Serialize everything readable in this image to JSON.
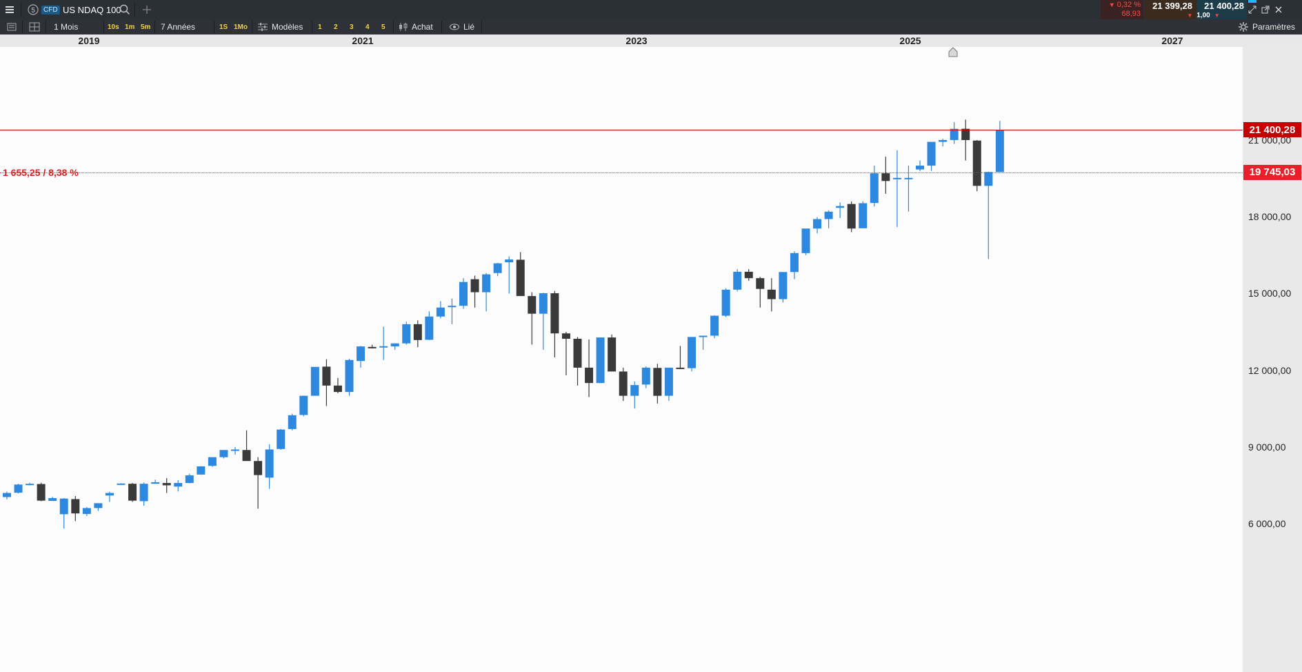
{
  "topbar": {
    "menu_icon": "hamburger-icon",
    "cfd_badge": "CFD",
    "instrument_name": "US NDAQ 100",
    "search_icon": "search-icon",
    "add_icon": "plus-icon",
    "change_pct": "0,32 %",
    "change_abs": "68,93",
    "bid": "21 399,28",
    "ask": "21 400,28",
    "spread": "1,00",
    "window_icons": [
      "restore-icon",
      "popout-icon",
      "close-icon"
    ]
  },
  "toolbar": {
    "period": "1 Mois",
    "intervals_small": [
      "10s",
      "1m",
      "5m"
    ],
    "range": "7 Années",
    "intervals_big": [
      "1S",
      "1Mo"
    ],
    "models": "Modèles",
    "numbers": [
      "1",
      "2",
      "3",
      "4",
      "5"
    ],
    "buy": "Achat",
    "linked": "Lié",
    "settings": "Paramètres"
  },
  "xaxis": {
    "years": [
      "2019",
      "2021",
      "2023",
      "2025",
      "2027"
    ]
  },
  "yaxis": {
    "labels": [
      "21 000,00",
      "18 000,00",
      "15 000,00",
      "12 000,00",
      "9 000,00",
      "6 000,00"
    ]
  },
  "price_lines": {
    "current_value": "21 400,28",
    "current_color": "#c40000",
    "reference_value": "19 745,03",
    "reference_color": "#e8202a",
    "difference_label": "1 655,25 / 8,38 %"
  },
  "colors": {
    "bull": "#2d89e0",
    "bear": "#3a3a3a",
    "toolbar_yellow": "#f2d43a"
  },
  "chart_data": {
    "type": "candlestick",
    "timeframe": "1 Mois",
    "x": [
      "2019-01",
      "2019-02",
      "2019-03",
      "2019-04",
      "2019-05",
      "2019-06",
      "2019-07",
      "2019-08",
      "2019-09",
      "2019-10",
      "2019-11",
      "2019-12",
      "2020-01",
      "2020-02",
      "2020-03",
      "2020-04",
      "2020-05",
      "2020-06",
      "2020-07",
      "2020-08",
      "2020-09",
      "2020-10",
      "2020-11",
      "2020-12",
      "2021-01",
      "2021-02",
      "2021-03",
      "2021-04",
      "2021-05",
      "2021-06",
      "2021-07",
      "2021-08",
      "2021-09",
      "2021-10",
      "2021-11",
      "2021-12",
      "2022-01",
      "2022-02",
      "2022-03",
      "2022-04",
      "2022-05",
      "2022-06",
      "2022-07",
      "2022-08",
      "2022-09",
      "2022-10",
      "2022-11",
      "2022-12",
      "2023-01",
      "2023-02",
      "2023-03",
      "2023-04",
      "2023-05",
      "2023-06",
      "2023-07",
      "2023-08",
      "2023-09",
      "2023-10",
      "2023-11",
      "2023-12",
      "2024-01",
      "2024-02",
      "2024-03",
      "2024-04",
      "2024-05",
      "2024-06",
      "2024-07",
      "2024-08",
      "2024-09",
      "2024-10",
      "2024-11",
      "2024-12",
      "2025-01",
      "2025-02",
      "2025-03",
      "2025-04",
      "2025-05",
      "2025-06"
    ],
    "series": [
      {
        "values": [
          [
            7040,
            7250,
            6950,
            7200
          ],
          [
            7210,
            7560,
            7180,
            7530
          ],
          [
            7540,
            7600,
            7500,
            7560
          ],
          [
            7550,
            7600,
            6880,
            6900
          ],
          [
            6890,
            7050,
            6900,
            7000
          ],
          [
            6370,
            7000,
            5810,
            6980
          ],
          [
            6960,
            7080,
            6100,
            6400
          ],
          [
            6380,
            6650,
            6300,
            6610
          ],
          [
            6610,
            6800,
            6500,
            6800
          ],
          [
            7100,
            7250,
            6850,
            7200
          ],
          [
            7560,
            7580,
            7520,
            7570
          ],
          [
            7560,
            7590,
            6850,
            6900
          ],
          [
            6880,
            7610,
            6700,
            7560
          ],
          [
            7560,
            7720,
            7560,
            7620
          ],
          [
            7590,
            7780,
            7200,
            7500
          ],
          [
            7450,
            7700,
            7260,
            7590
          ],
          [
            7590,
            7950,
            7580,
            7890
          ],
          [
            7920,
            8250,
            7910,
            8240
          ],
          [
            8260,
            8600,
            8220,
            8600
          ],
          [
            8600,
            8850,
            8550,
            8880
          ],
          [
            8880,
            9000,
            8700,
            8900
          ],
          [
            8880,
            9650,
            8680,
            8450
          ],
          [
            8450,
            8600,
            6590,
            7900
          ],
          [
            7800,
            9100,
            7360,
            8900
          ],
          [
            8920,
            9700,
            8890,
            9680
          ],
          [
            9700,
            10300,
            9650,
            10240
          ],
          [
            10250,
            11000,
            10200,
            11000
          ],
          [
            11000,
            11100,
            11050,
            12130
          ],
          [
            12140,
            12430,
            10600,
            11400
          ],
          [
            11400,
            11700,
            11100,
            11150
          ],
          [
            11150,
            12450,
            11000,
            12400
          ],
          [
            12360,
            12950,
            12100,
            12930
          ],
          [
            12910,
            13000,
            12850,
            12900
          ],
          [
            12930,
            13700,
            12400,
            12940
          ],
          [
            12930,
            13050,
            12800,
            13050
          ],
          [
            13050,
            13900,
            13000,
            13800
          ],
          [
            13800,
            13950,
            12900,
            13180
          ],
          [
            13190,
            14300,
            13180,
            14100
          ],
          [
            14100,
            14700,
            14030,
            14450
          ],
          [
            14520,
            14800,
            13800,
            14520
          ],
          [
            14520,
            15600,
            14400,
            15450
          ],
          [
            15560,
            15700,
            14450,
            15050
          ],
          [
            15050,
            15800,
            14300,
            15750
          ],
          [
            15800,
            16200,
            15680,
            16180
          ],
          [
            16220,
            16450,
            15000,
            16330
          ],
          [
            16320,
            16620,
            15900,
            14900
          ],
          [
            14900,
            15050,
            13000,
            14210
          ],
          [
            14210,
            15030,
            12800,
            15010
          ],
          [
            15010,
            15100,
            12500,
            13440
          ],
          [
            13440,
            13500,
            11800,
            13230
          ],
          [
            13230,
            13300,
            11400,
            12100
          ],
          [
            12100,
            13200,
            10950,
            11500
          ],
          [
            11500,
            13280,
            11500,
            13280
          ],
          [
            13280,
            13400,
            12000,
            11950
          ],
          [
            11950,
            12100,
            10800,
            11000
          ],
          [
            11000,
            11560,
            10500,
            11420
          ],
          [
            11440,
            12150,
            11300,
            12100
          ],
          [
            12090,
            12250,
            10700,
            11000
          ],
          [
            11000,
            12100,
            10800,
            12100
          ],
          [
            12100,
            12950,
            12050,
            12080
          ],
          [
            12080,
            13300,
            11950,
            13300
          ],
          [
            13300,
            13350,
            12800,
            13350
          ],
          [
            13350,
            14150,
            13250,
            14130
          ],
          [
            14130,
            15200,
            14080,
            15150
          ],
          [
            15150,
            15950,
            15080,
            15850
          ],
          [
            15850,
            15950,
            15500,
            15600
          ],
          [
            15600,
            15650,
            14450,
            15180
          ],
          [
            15150,
            15600,
            14300,
            14780
          ],
          [
            14780,
            15800,
            14650,
            15840
          ],
          [
            15840,
            16650,
            15560,
            16580
          ],
          [
            16580,
            17400,
            16500,
            17540
          ],
          [
            17540,
            17990,
            17350,
            17910
          ],
          [
            17910,
            18250,
            17550,
            18200
          ],
          [
            18350,
            18560,
            17950,
            18420
          ],
          [
            18500,
            18600,
            17400,
            17540
          ],
          [
            17550,
            18600,
            17700,
            18530
          ],
          [
            18540,
            20000,
            18400,
            19700
          ],
          [
            19700,
            20350,
            18900,
            19400
          ],
          [
            19500,
            20600,
            17600,
            19520
          ],
          [
            19520,
            20000,
            18200,
            19520
          ],
          [
            19850,
            20200,
            19780,
            20000
          ],
          [
            20000,
            20900,
            19800,
            20930
          ],
          [
            20930,
            21050,
            20750,
            21000
          ],
          [
            21000,
            21700,
            20850,
            21440
          ],
          [
            21440,
            21800,
            20200,
            21000
          ],
          [
            20980,
            21000,
            19000,
            19210
          ],
          [
            19210,
            19760,
            16350,
            19750
          ],
          [
            19750,
            21750,
            19750,
            21400
          ]
        ]
      }
    ],
    "ylim": [
      5500,
      22800
    ],
    "yticks": [
      6000,
      9000,
      12000,
      15000,
      18000,
      21000
    ]
  }
}
